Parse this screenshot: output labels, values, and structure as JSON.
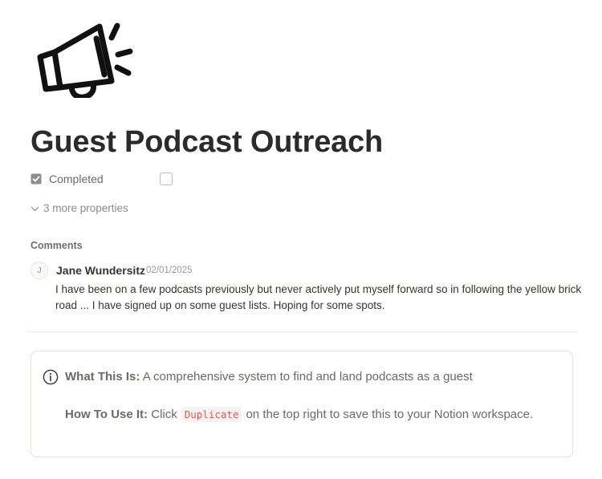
{
  "page": {
    "icon": "megaphone-icon",
    "title": "Guest Podcast Outreach"
  },
  "properties": [
    {
      "icon": "checkbox-property-icon",
      "name": "Completed",
      "checked": false
    }
  ],
  "more_properties": {
    "icon": "chevron-down-icon",
    "label": "3 more properties"
  },
  "comments": {
    "heading": "Comments",
    "items": [
      {
        "avatar_initial": "J",
        "author": "Jane Wundersitz",
        "date": "02/01/2025",
        "text": "I have been on a few podcasts previously but never actively put myself forward so in following the yellow brick road ... I have signed up on some guest lists. Hoping for some spots."
      }
    ]
  },
  "callout": {
    "icon": "info-circle-icon",
    "line1_label": "What This Is:",
    "line1_text": "A comprehensive system to find and land podcasts as a guest",
    "line2_label": "How To Use It:",
    "line2_pre": "Click",
    "line2_code": "Duplicate",
    "line2_post": "on the top right to save this to your Notion workspace."
  },
  "colors": {
    "text": "#37352f",
    "muted": "#6b6a66",
    "code_text": "#eb5757",
    "code_bg": "#f4f3f1",
    "border": "#e3e2de"
  }
}
